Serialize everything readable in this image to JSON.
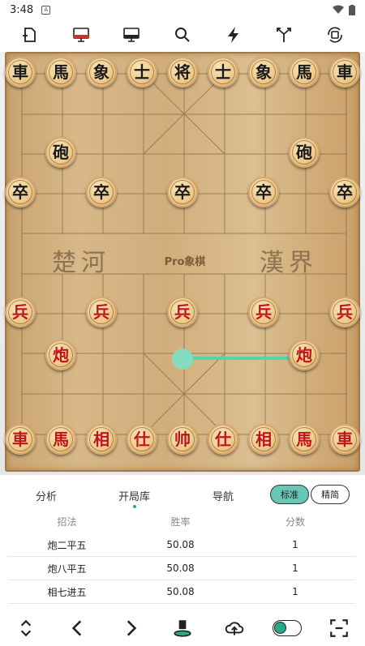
{
  "status_bar": {
    "time": "3:48",
    "notification": "A"
  },
  "toolbar": {
    "icons": [
      "new-game-icon",
      "red-monitor-icon",
      "monitor-icon",
      "search-icon",
      "lightning-icon",
      "branch-icon",
      "flip-board-icon"
    ]
  },
  "board": {
    "river_left": "楚河",
    "river_right": "漢界",
    "brand": "Pro象棋",
    "black_back_row": [
      "車",
      "馬",
      "象",
      "士",
      "将",
      "士",
      "象",
      "馬",
      "車"
    ],
    "black_cannons": [
      "砲",
      "砲"
    ],
    "black_pawns": [
      "卒",
      "卒",
      "卒",
      "卒",
      "卒"
    ],
    "red_pawns": [
      "兵",
      "兵",
      "兵",
      "兵",
      "兵"
    ],
    "red_cannons": [
      "炮",
      "炮"
    ],
    "red_back_row": [
      "車",
      "馬",
      "相",
      "仕",
      "帅",
      "仕",
      "相",
      "馬",
      "車"
    ]
  },
  "tabs": {
    "analysis": "分析",
    "opening_book": "开局库",
    "navigation": "导航",
    "standard": "标准",
    "compact": "精简"
  },
  "table": {
    "headers": {
      "move": "招法",
      "win_rate": "胜率",
      "score": "分数"
    },
    "rows": [
      {
        "move": "炮二平五",
        "win_rate": "50.08",
        "score": "1"
      },
      {
        "move": "炮八平五",
        "win_rate": "50.08",
        "score": "1"
      },
      {
        "move": "相七进五",
        "win_rate": "50.08",
        "score": "1"
      }
    ]
  },
  "colors": {
    "accent": "#2aa98a",
    "red_piece": "#c0141c",
    "black_piece": "#1a1a1a"
  },
  "bottom_bar": {
    "icons": [
      "expand-collapse-icon",
      "previous-icon",
      "next-icon",
      "hat-icon",
      "cloud-upload-icon",
      "toggle-switch",
      "fullscreen-icon"
    ]
  }
}
